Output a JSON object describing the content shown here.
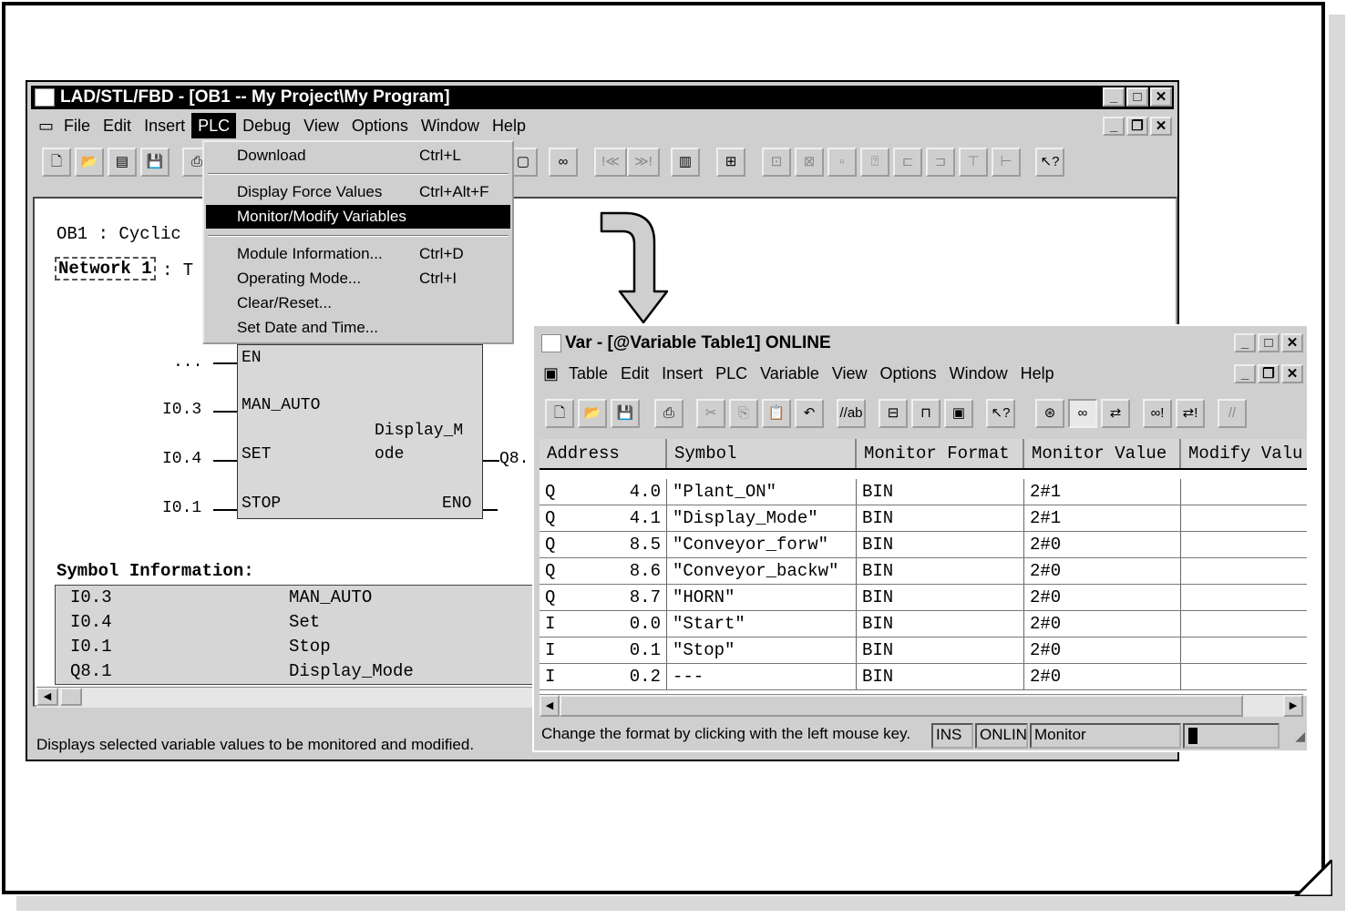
{
  "editor_window": {
    "title": "LAD/STL/FBD  - [OB1 -- My Project\\My Program]",
    "menu": [
      "File",
      "Edit",
      "Insert",
      "PLC",
      "Debug",
      "View",
      "Options",
      "Window",
      "Help"
    ],
    "active_menu": "PLC",
    "block_title": "OB1 : Cyclic",
    "network_label": "Network 1",
    "network_suffix": ": T",
    "fbd": {
      "inputs": [
        {
          "operand": "...",
          "pin": "EN"
        },
        {
          "operand": "I0.3",
          "pin": "MAN_AUTO"
        },
        {
          "operand": "I0.4",
          "pin": "SET"
        },
        {
          "operand": "I0.1",
          "pin": "STOP"
        }
      ],
      "block_name_1": "Display_M",
      "block_name_2": "ode",
      "output_operand": "Q8.",
      "eno_pin": "ENO"
    },
    "symbol_info_title": "Symbol Information:",
    "symbol_info": [
      {
        "address": "I0.3",
        "symbol": "MAN_AUTO"
      },
      {
        "address": "I0.4",
        "symbol": "Set"
      },
      {
        "address": "I0.1",
        "symbol": "Stop"
      },
      {
        "address": "Q8.1",
        "symbol": "Display_Mode"
      }
    ],
    "status_text": "Displays selected variable values to be monitored and modified."
  },
  "plc_menu": {
    "items": [
      {
        "label": "Download",
        "accel": "Ctrl+L"
      },
      {
        "label": "Display Force Values",
        "accel": "Ctrl+Alt+F"
      },
      {
        "label": "Monitor/Modify Variables",
        "accel": ""
      },
      {
        "label": "Module Information...",
        "accel": "Ctrl+D"
      },
      {
        "label": "Operating Mode...",
        "accel": "Ctrl+I"
      },
      {
        "label": "Clear/Reset...",
        "accel": ""
      },
      {
        "label": "Set Date and Time...",
        "accel": ""
      }
    ],
    "highlighted": "Monitor/Modify Variables"
  },
  "var_window": {
    "title": "Var - [@Variable Table1]  ONLINE",
    "menu": [
      "Table",
      "Edit",
      "Insert",
      "PLC",
      "Variable",
      "View",
      "Options",
      "Window",
      "Help"
    ],
    "columns": [
      "Address",
      "Symbol",
      "Monitor Format",
      "Monitor Value",
      "Modify Valu"
    ],
    "rows": [
      {
        "op": "Q",
        "addr": "4.0",
        "symbol": "\"Plant_ON\"",
        "format": "BIN",
        "value": "2#1"
      },
      {
        "op": "Q",
        "addr": "4.1",
        "symbol": "\"Display_Mode\"",
        "format": "BIN",
        "value": "2#1"
      },
      {
        "op": "Q",
        "addr": "8.5",
        "symbol": "\"Conveyor_forw\"",
        "format": "BIN",
        "value": "2#0"
      },
      {
        "op": "Q",
        "addr": "8.6",
        "symbol": "\"Conveyor_backw\"",
        "format": "BIN",
        "value": "2#0"
      },
      {
        "op": "Q",
        "addr": "8.7",
        "symbol": "\"HORN\"",
        "format": "BIN",
        "value": "2#0"
      },
      {
        "op": "I",
        "addr": "0.0",
        "symbol": "\"Start\"",
        "format": "BIN",
        "value": "2#0"
      },
      {
        "op": "I",
        "addr": "0.1",
        "symbol": "\"Stop\"",
        "format": "BIN",
        "value": "2#0"
      },
      {
        "op": "I",
        "addr": "0.2",
        "symbol": "---",
        "format": "BIN",
        "value": "2#0"
      }
    ],
    "status_text": "Change the format by clicking with the left mouse key.",
    "status_ins": "INS",
    "status_onl": "ONLIN",
    "status_mode": "Monitor"
  }
}
